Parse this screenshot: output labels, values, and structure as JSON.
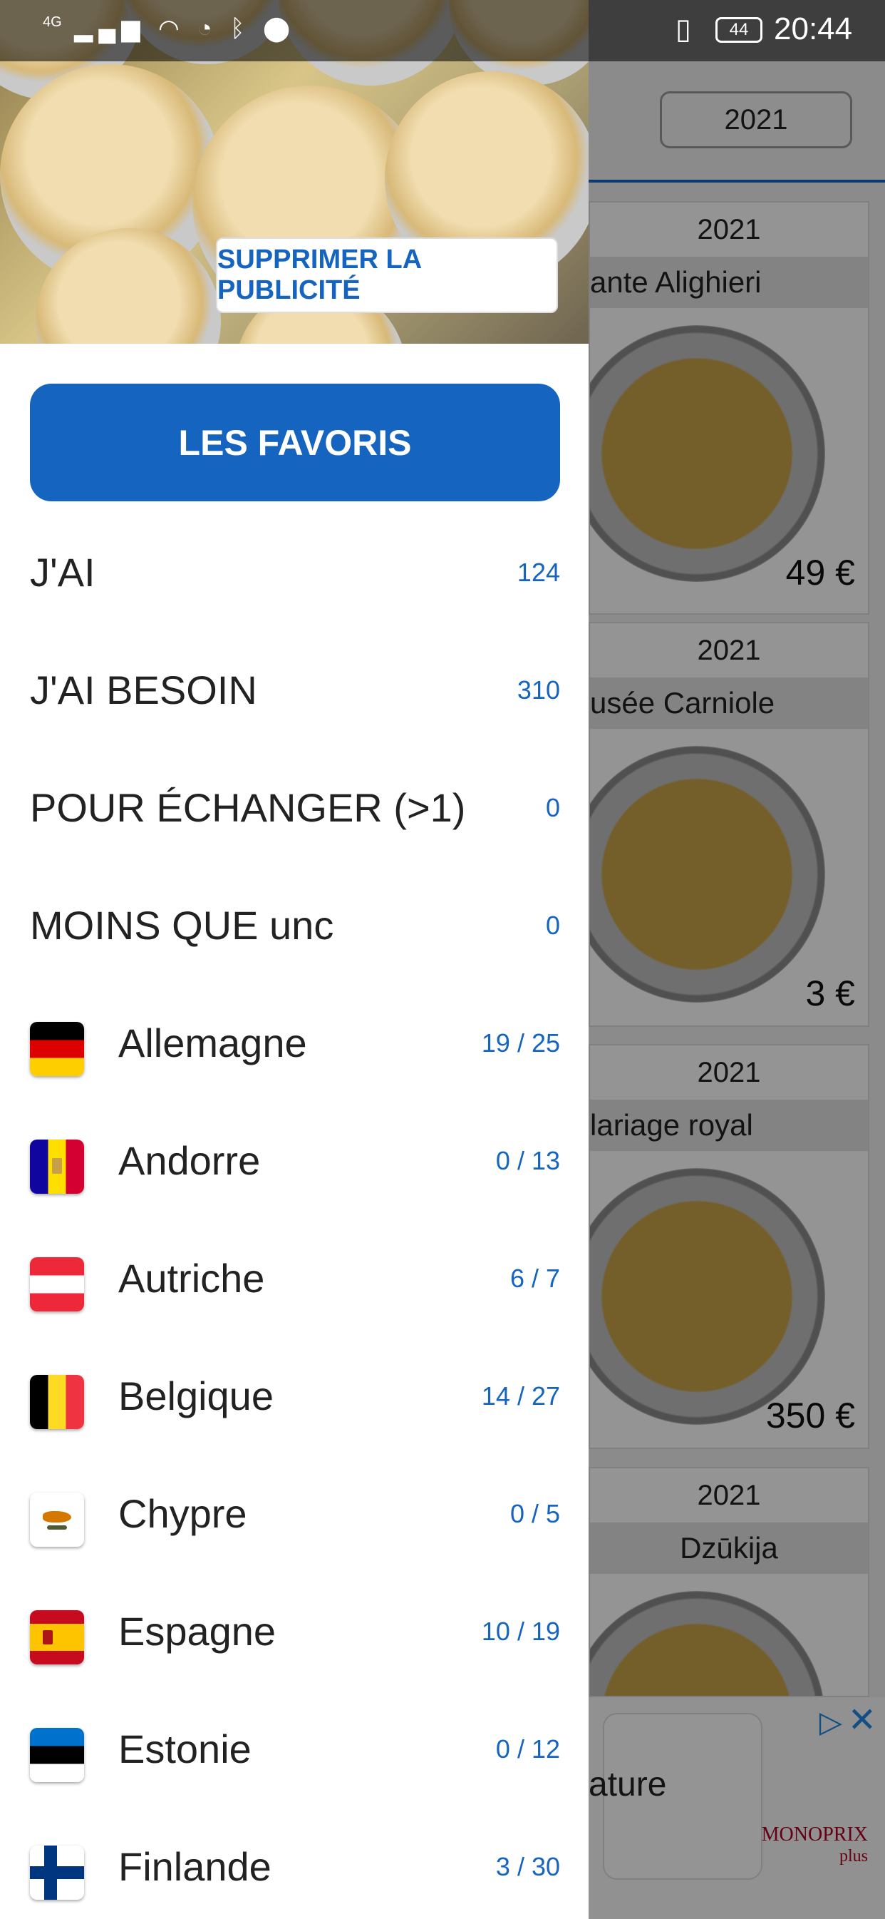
{
  "status_bar": {
    "network": "4G",
    "battery": "44",
    "time": "20:44"
  },
  "background": {
    "year_selector": "2021",
    "cards": [
      {
        "year": "2021",
        "name": "ante Alighieri",
        "price": "49 €"
      },
      {
        "year": "2021",
        "name": "usée Carniole",
        "price": "3 €"
      },
      {
        "year": "2021",
        "name": "lariage royal",
        "price": "350 €"
      },
      {
        "year": "2021",
        "name": "Dzūkija",
        "price": ""
      }
    ],
    "ad": {
      "text": "ature",
      "brand_line1": "MONOPRIX",
      "brand_line2": "plus"
    }
  },
  "drawer": {
    "remove_ads_label": "SUPPRIMER LA PUBLICITÉ",
    "favorites_label": "LES FAVORIS",
    "menu": [
      {
        "label": "J'AI",
        "count": "124"
      },
      {
        "label": "J'AI BESOIN",
        "count": "310"
      },
      {
        "label": "POUR ÉCHANGER (>1)",
        "count": "0"
      },
      {
        "label": "MOINS QUE unc",
        "count": "0"
      }
    ],
    "countries": [
      {
        "label": "Allemagne",
        "count": "19 / 25",
        "flag": "germany"
      },
      {
        "label": "Andorre",
        "count": "0 / 13",
        "flag": "andorra"
      },
      {
        "label": "Autriche",
        "count": "6 / 7",
        "flag": "austria"
      },
      {
        "label": "Belgique",
        "count": "14 / 27",
        "flag": "belgium"
      },
      {
        "label": "Chypre",
        "count": "0 / 5",
        "flag": "cyprus"
      },
      {
        "label": "Espagne",
        "count": "10 / 19",
        "flag": "spain"
      },
      {
        "label": "Estonie",
        "count": "0 / 12",
        "flag": "estonia"
      },
      {
        "label": "Finlande",
        "count": "3 / 30",
        "flag": "finland"
      }
    ]
  },
  "colors": {
    "accent": "#1565c0",
    "count": "#1565c0"
  }
}
